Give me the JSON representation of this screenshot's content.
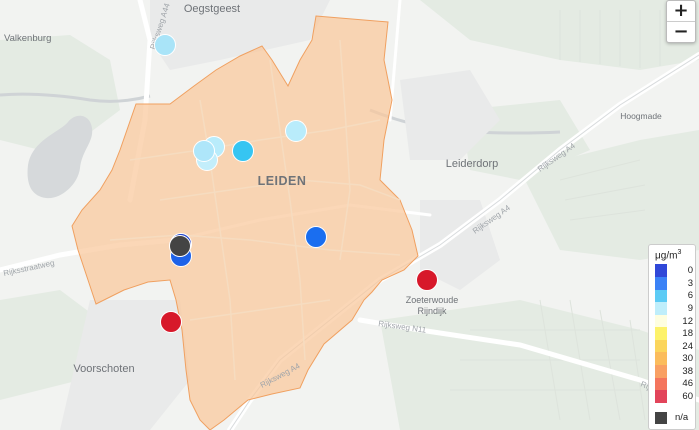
{
  "map": {
    "places": {
      "oegstgeest": "Oegstgeest",
      "valkenburg": "Valkenburg",
      "leiden": "LEIDEN",
      "leiderdorp": "Leiderdorp",
      "hoogmade": "Hoogmade",
      "zoeterwoude_line1": "Zoeterwoude",
      "zoeterwoude_line2": "Rijndijk",
      "voorschoten": "Voorschoten"
    },
    "roads": {
      "a44_north": "Rijksweg A44",
      "a44_west": "Rijksstraatweg",
      "a4_east": "Rijksweg A4",
      "a4_mid": "Rijksweg A4",
      "a4_south": "Rijksweg A4",
      "n11": "Rijksweg N11",
      "a4_south2": "Rijksweg A4"
    },
    "area_color": "#f9c89b",
    "area_stroke": "#f0a060",
    "sensors": [
      {
        "id": "s1",
        "value": 7,
        "color": "#a9e4f8"
      },
      {
        "id": "s2",
        "value": 8,
        "color": "#b9ecfb"
      },
      {
        "id": "s3",
        "value": 8,
        "color": "#b9ecfb"
      },
      {
        "id": "s4",
        "value": 8,
        "color": "#c3eefb"
      },
      {
        "id": "s5",
        "value": 7,
        "color": "#aee6fa"
      },
      {
        "id": "s6",
        "value": 5,
        "color": "#36c5f2"
      },
      {
        "id": "s7",
        "value": 2,
        "color": "#1a6ef0"
      },
      {
        "id": "s8",
        "value": 1,
        "color": "#2244cc"
      },
      {
        "id": "s9",
        "value": 2,
        "color": "#1e62e8"
      },
      {
        "id": "s10",
        "value": "n/a",
        "color": "#444444"
      },
      {
        "id": "s11",
        "value": 60,
        "color": "#d7182a"
      },
      {
        "id": "s12",
        "value": 60,
        "color": "#d7182a"
      }
    ]
  },
  "zoom": {
    "in_label": "+",
    "out_label": "−"
  },
  "legend": {
    "unit": "μg/m",
    "unit_exp": "3",
    "items": [
      {
        "label": "0",
        "color": "#3048d8"
      },
      {
        "label": "3",
        "color": "#3b82f6"
      },
      {
        "label": "6",
        "color": "#5ccbf5"
      },
      {
        "label": "9",
        "color": "#bfeefb"
      },
      {
        "label": "12",
        "color": "#fefee0"
      },
      {
        "label": "18",
        "color": "#fdf26a"
      },
      {
        "label": "24",
        "color": "#fbd55c"
      },
      {
        "label": "30",
        "color": "#fbbc5c"
      },
      {
        "label": "38",
        "color": "#f9a063"
      },
      {
        "label": "46",
        "color": "#f4755d"
      },
      {
        "label": "60",
        "color": "#e2445a"
      }
    ],
    "na": {
      "label": "n/a",
      "color": "#444444"
    }
  }
}
